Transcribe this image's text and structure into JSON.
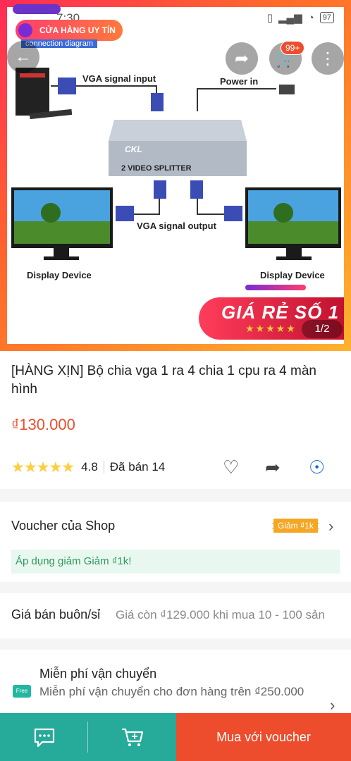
{
  "status_bar": {
    "time": "7:30",
    "battery": "97"
  },
  "hero": {
    "shop_label": "CỬA HÀNG UY TÍN",
    "caption": "connection diagram",
    "cart_badge": "99+",
    "image_counter": "1/2",
    "promo_text": "GIÁ RẺ SỐ 1",
    "promo_stars": "★★★★★",
    "diagram": {
      "vga_input": "VGA signal input",
      "power_in": "Power in",
      "vga_output": "VGA signal output",
      "display_left": "Display Device",
      "display_right": "Display Device",
      "brand": "CKL",
      "splitter_label": "2 VIDEO SPLITTER"
    }
  },
  "product": {
    "title": "[HÀNG XỊN] Bộ chia vga 1 ra 4 chia 1 cpu ra 4 màn hình",
    "price": "₫130.000",
    "rating": "4.8",
    "sold": "Đã bán 14"
  },
  "voucher": {
    "title": "Voucher của Shop",
    "tag": "Giảm ₫1k",
    "apply_text": "Áp dụng giảm Giảm ₫1k!"
  },
  "wholesale": {
    "label": "Giá bán buôn/sỉ",
    "value": "Giá còn ₫129.000 khi mua 10 - 100 sản"
  },
  "shipping": {
    "title": "Miễn phí vận chuyển",
    "desc": "Miễn phí vận chuyển cho đơn hàng trên ₫250.000",
    "icon_text": "Free"
  },
  "bottom_bar": {
    "buy_label": "Mua với voucher"
  }
}
